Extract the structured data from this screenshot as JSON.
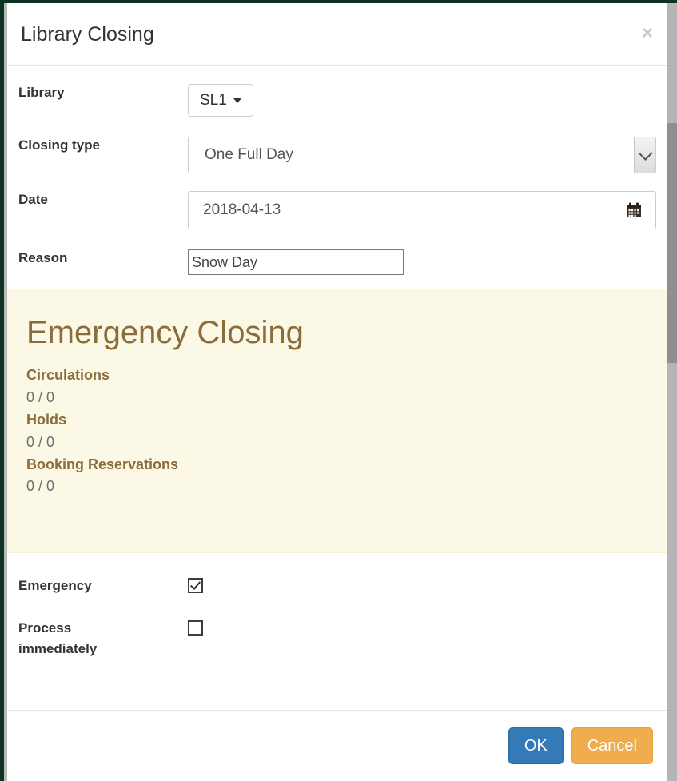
{
  "dialog": {
    "title": "Library Closing",
    "close_label": "×"
  },
  "form": {
    "library": {
      "label": "Library",
      "value": "SL1"
    },
    "closing_type": {
      "label": "Closing type",
      "value": "One Full Day",
      "options": [
        "One Full Day"
      ]
    },
    "date": {
      "label": "Date",
      "value": "2018-04-13",
      "placeholder": "",
      "calendar_icon": "calendar-icon"
    },
    "reason": {
      "label": "Reason",
      "value": "Snow Day",
      "placeholder": ""
    }
  },
  "alert": {
    "heading": "Emergency Closing",
    "stats": [
      {
        "label": "Circulations",
        "value": "0 / 0"
      },
      {
        "label": "Holds",
        "value": "0 / 0"
      },
      {
        "label": "Booking Reservations",
        "value": "0 / 0"
      }
    ]
  },
  "checkboxes": {
    "emergency": {
      "label": "Emergency",
      "checked": true
    },
    "process_immediately": {
      "label_line1": "Process",
      "label_line2": "immediately",
      "checked": false
    }
  },
  "footer": {
    "ok_label": "OK",
    "cancel_label": "Cancel"
  },
  "colors": {
    "page_border": "#0d3321",
    "alert_bg": "#fcf8e6",
    "alert_text": "#8a6d3b",
    "ok_button": "#337ab7",
    "cancel_button": "#f0ad4e"
  }
}
